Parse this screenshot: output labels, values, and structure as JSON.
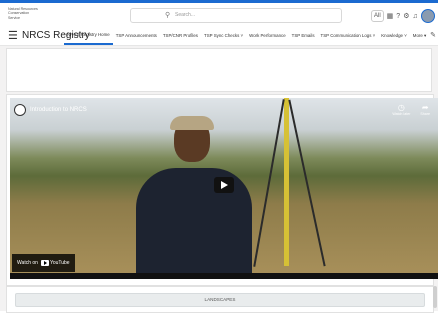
{
  "header": {
    "logo_text": "Natural Resources Conservation Service",
    "search_placeholder": "Search...",
    "icons": [
      "all-filter-icon",
      "grid-icon",
      "help-icon",
      "gear-icon",
      "bell-icon",
      "avatar"
    ],
    "filter_label": "All"
  },
  "nav": {
    "app_name": "NRCS Registry",
    "tabs": [
      "NRCS Registry Home",
      "TSP Announcements",
      "TSP/CNR Profiles",
      "TSP Sync Checks",
      "Work Performance",
      "TSP Emails",
      "TSP Communication Logs",
      "Knowledge",
      "More"
    ]
  },
  "video": {
    "title": "Introduction to NRCS",
    "watch_later": "Watch later",
    "share": "Share",
    "watch_on": "Watch on",
    "youtube": "YouTube"
  },
  "footer_button": "LANDSCAPES",
  "colors": {
    "accent": "#1b6ad0"
  }
}
